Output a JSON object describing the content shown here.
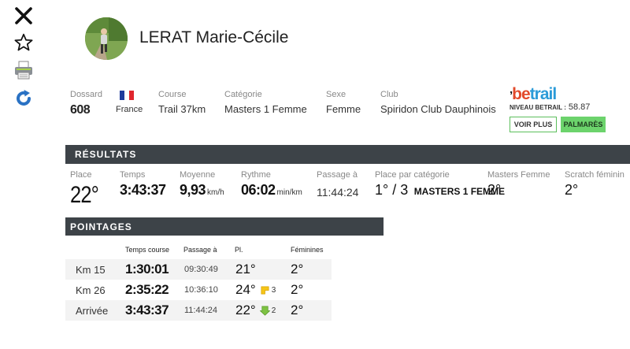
{
  "toolbar": {
    "close_icon": "close-icon",
    "star_icon": "star-icon",
    "print_icon": "print-icon",
    "refresh_icon": "refresh-icon"
  },
  "athlete": {
    "name": "LERAT Marie-Cécile"
  },
  "info": {
    "bib_label": "Dossard",
    "bib_value": "608",
    "country_value": "France",
    "course_label": "Course",
    "course_value": "Trail 37km",
    "category_label": "Catégorie",
    "category_value": "Masters 1 Femme",
    "sex_label": "Sexe",
    "sex_value": "Femme",
    "club_label": "Club",
    "club_value": "Spiridon Club Dauphinois"
  },
  "betrail": {
    "logo_prefix": "be",
    "logo_suffix": "trail",
    "level_label": "NIVEAU BETRAIL :",
    "level_value": "58.87",
    "voir_plus_label": "VOIR PLUS",
    "palmares_label": "PALMARÈS"
  },
  "results": {
    "section_title": "RÉSULTATS",
    "place_label": "Place",
    "place_value": "22°",
    "temps_label": "Temps",
    "temps_value": "3:43:37",
    "moyenne_label": "Moyenne",
    "moyenne_value": "9,93",
    "moyenne_unit": "km/h",
    "rythme_label": "Rythme",
    "rythme_value": "06:02",
    "rythme_unit": "min/km",
    "passage_label": "Passage à",
    "passage_value": "11:44:24",
    "cat_place_label": "Place par catégorie",
    "cat_place_value": "1° / 3",
    "cat_place_category": "MASTERS 1 FEMME",
    "masters_label": "Masters Femme",
    "masters_value": "2°",
    "scratch_label": "Scratch féminin",
    "scratch_value": "2°"
  },
  "pointages": {
    "section_title": "POINTAGES",
    "headers": {
      "temps": "Temps course",
      "passage": "Passage à",
      "pl": "Pl.",
      "feminines": "Féminines"
    },
    "rows": [
      {
        "label": "Km 15",
        "temps": "1:30:01",
        "passage": "09:30:49",
        "pl": "21°",
        "trend": "",
        "trend_value": "",
        "fem": "2°"
      },
      {
        "label": "Km 26",
        "temps": "2:35:22",
        "passage": "10:36:10",
        "pl": "24°",
        "trend": "down",
        "trend_value": "3",
        "fem": "2°"
      },
      {
        "label": "Arrivée",
        "temps": "3:43:37",
        "passage": "11:44:24",
        "pl": "22°",
        "trend": "up",
        "trend_value": "2",
        "fem": "2°"
      }
    ]
  },
  "colors": {
    "section_bar": "#3d4348",
    "accent_green": "#6cd36c",
    "trend_down": "#f5c518",
    "trend_up": "#7dc242"
  }
}
